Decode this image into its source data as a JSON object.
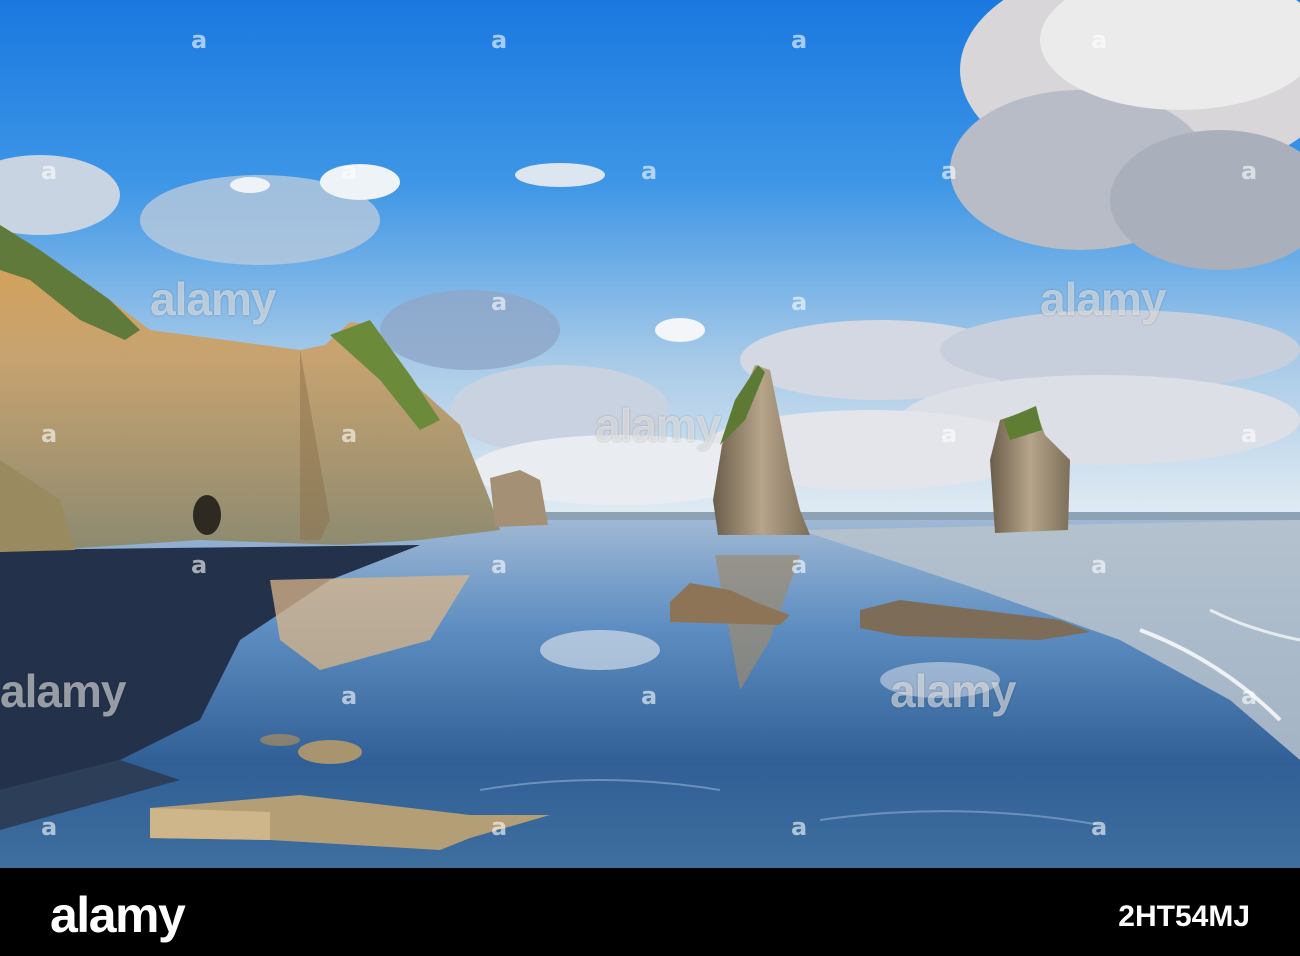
{
  "photo": {
    "description_icon": "coastal-sea-stacks-photo",
    "colors": {
      "sky_top": "#1f7fe0",
      "sky_horizon": "#cfe3f4",
      "cliff": "#c9a46a",
      "sand": "#1c2a3c",
      "water": "#5b8fc8"
    }
  },
  "watermark": {
    "text": "alamy",
    "dot": "a"
  },
  "footer": {
    "brand": "alamy",
    "image_id": "2HT54MJ"
  }
}
